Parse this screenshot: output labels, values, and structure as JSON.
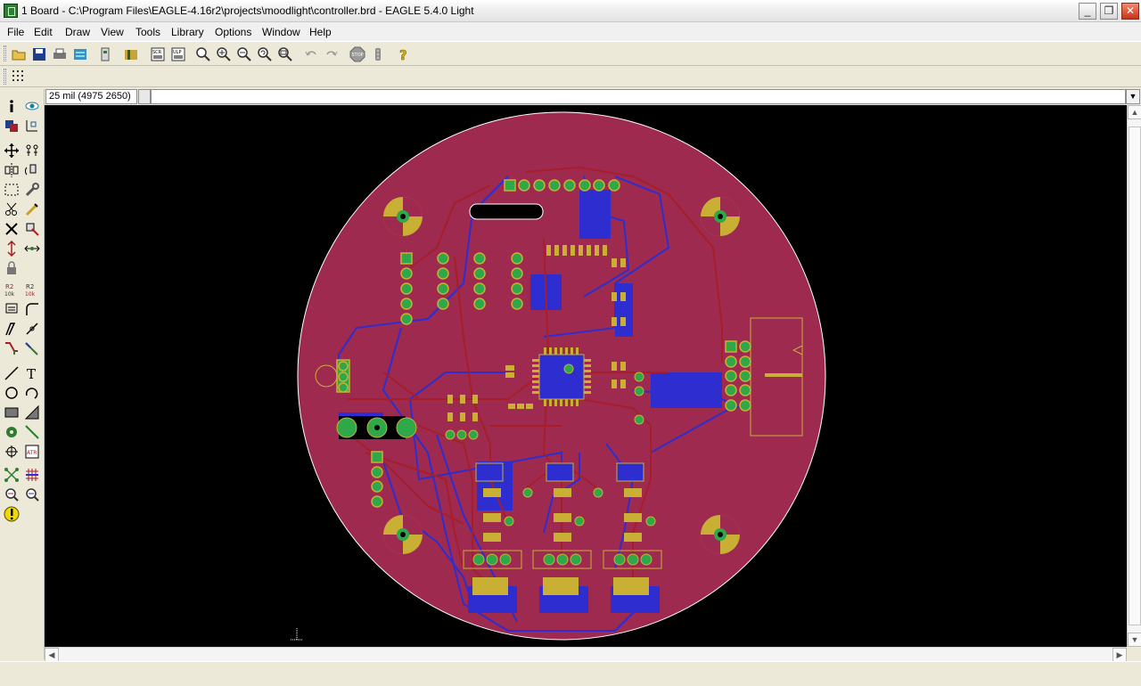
{
  "window": {
    "title": "1 Board - C:\\Program Files\\EAGLE-4.16r2\\projects\\moodlight\\controller.brd - EAGLE 5.4.0 Light",
    "minimize_label": "_",
    "restore_label": "❐",
    "close_label": "✕"
  },
  "menu": {
    "items": [
      {
        "label": "File"
      },
      {
        "label": "Edit"
      },
      {
        "label": "Draw"
      },
      {
        "label": "View"
      },
      {
        "label": "Tools"
      },
      {
        "label": "Library"
      },
      {
        "label": "Options"
      },
      {
        "label": "Window"
      },
      {
        "label": "Help"
      }
    ]
  },
  "toolbar": {
    "icons": [
      "open-icon",
      "save-icon",
      "print-icon",
      "cam-icon",
      "board-schematic-switch-icon",
      "use-library-icon",
      "script-icon",
      "ulp-icon",
      "zoom-fit-icon",
      "zoom-in-icon",
      "zoom-out-icon",
      "zoom-redraw-icon",
      "zoom-select-icon",
      "undo-icon",
      "redo-icon",
      "stop-icon",
      "go-icon",
      "help-icon"
    ]
  },
  "coords": {
    "display": "25 mil (4975 2650)"
  },
  "command": {
    "value": "",
    "placeholder": ""
  },
  "palette": {
    "icons": [
      "info-icon",
      "show-icon",
      "display-icon",
      "mark-icon",
      "move-icon",
      "copy-icon",
      "mirror-icon",
      "rotate-icon",
      "group-icon",
      "change-icon",
      "cut-icon",
      "paste-icon",
      "delete-icon",
      "add-icon",
      "pinswap-icon",
      "replace-icon",
      "lock-icon",
      "name-icon",
      "value-icon",
      "smash-icon",
      "miter-icon",
      "split-icon",
      "optimize-icon",
      "route-icon",
      "ripup-icon",
      "wire-icon",
      "text-icon",
      "circle-icon",
      "arc-icon",
      "rect-icon",
      "polygon-icon",
      "via-icon",
      "signal-icon",
      "hole-icon",
      "attribute-icon",
      "ratsnest-icon",
      "auto-icon",
      "erc-icon",
      "drc-icon",
      "errors-icon"
    ]
  },
  "board": {
    "fill_color": "#9e2a4f",
    "outline_color": "#ffffff",
    "top_trace_color": "#a61e28",
    "bottom_trace_color": "#2d2dd0",
    "pad_color": "#2fa84a",
    "pad_ring_color": "#c9b035"
  }
}
